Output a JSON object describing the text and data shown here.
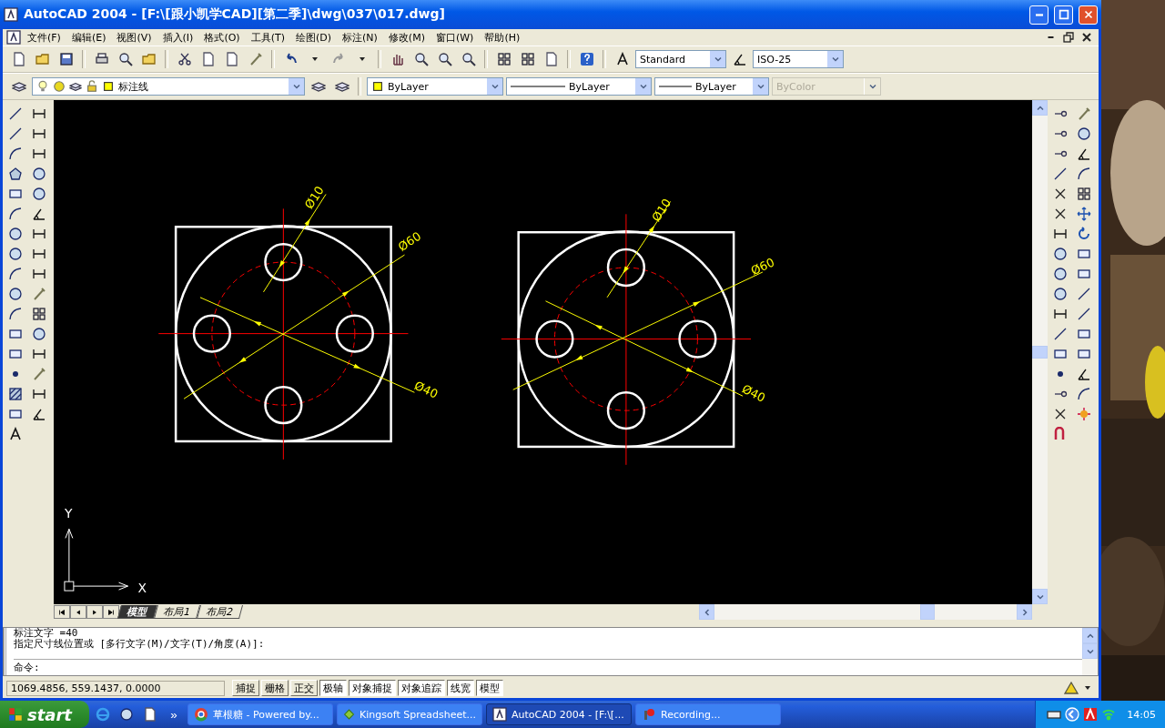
{
  "window": {
    "title": "AutoCAD 2004 - [F:\\[跟小凯学CAD][第二季]\\dwg\\037\\017.dwg]"
  },
  "menu": [
    "文件(F)",
    "编辑(E)",
    "视图(V)",
    "插入(I)",
    "格式(O)",
    "工具(T)",
    "绘图(D)",
    "标注(N)",
    "修改(M)",
    "窗口(W)",
    "帮助(H)"
  ],
  "styles": {
    "text_style": "Standard",
    "dim_style": "ISO-25"
  },
  "properties": {
    "layer": "标注线",
    "color_setting": "ByLayer",
    "linetype": "ByLayer",
    "lineweight": "ByLayer",
    "plot_style": {
      "value": "ByColor",
      "disabled": true
    }
  },
  "drawing": {
    "parts": [
      {
        "hole_dim": "Ø10",
        "outer_dim": "Ø60",
        "bolt_dim": "Ø40"
      },
      {
        "hole_dim": "Ø10",
        "outer_dim": "Ø60",
        "bolt_dim": "Ø40"
      }
    ],
    "ucs": {
      "x": "X",
      "y": "Y"
    }
  },
  "layout_tabs": [
    {
      "label": "模型",
      "selected": true
    },
    {
      "label": "布局1",
      "selected": false
    },
    {
      "label": "布局2",
      "selected": false
    }
  ],
  "command": {
    "history": [
      "标注文字 =40",
      "指定尺寸线位置或 [多行文字(M)/文字(T)/角度(A)]:"
    ],
    "prompt": "命令:"
  },
  "status": {
    "coordinates": "1069.4856, 559.1437, 0.0000",
    "toggles": [
      {
        "label": "捕捉",
        "on": false
      },
      {
        "label": "栅格",
        "on": false
      },
      {
        "label": "正交",
        "on": false
      },
      {
        "label": "极轴",
        "on": true
      },
      {
        "label": "对象捕捉",
        "on": true
      },
      {
        "label": "对象追踪",
        "on": true
      },
      {
        "label": "线宽",
        "on": true
      },
      {
        "label": "模型",
        "on": true
      }
    ]
  },
  "taskbar": {
    "start": "start",
    "more": "»",
    "tasks": [
      {
        "label": "草根糖 - Powered by...",
        "active": false
      },
      {
        "label": "Kingsoft Spreadsheet...",
        "active": false
      },
      {
        "label": "AutoCAD 2004 - [F:\\[...",
        "active": true
      },
      {
        "label": "Recording...",
        "active": false
      }
    ],
    "clock": "14:05"
  }
}
